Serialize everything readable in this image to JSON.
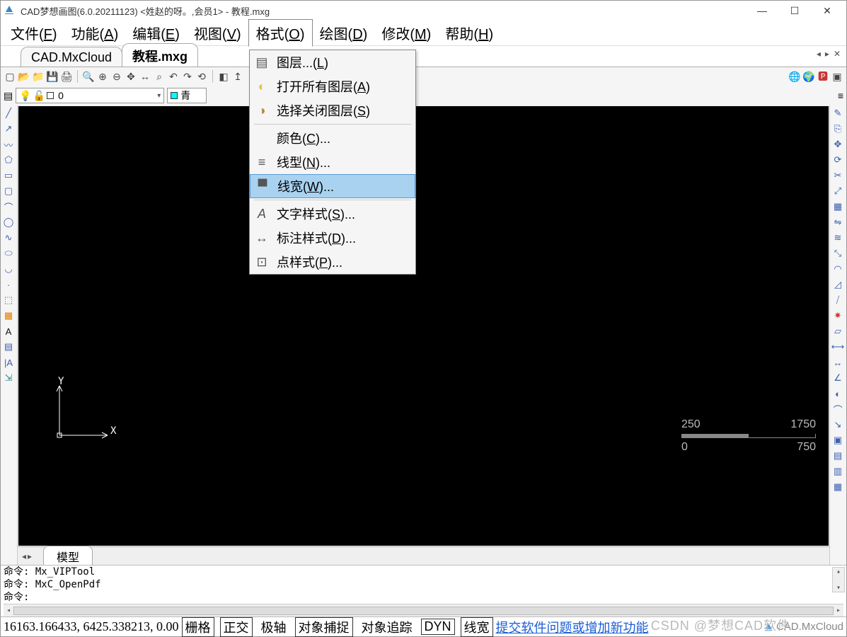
{
  "window": {
    "title": "CAD梦想画图(6.0.20211123) <姓赵的呀。,会员1> - 教程.mxg"
  },
  "menu": {
    "items": [
      {
        "label": "文件(",
        "u": "F",
        "tail": ")"
      },
      {
        "label": "功能(",
        "u": "A",
        "tail": ")"
      },
      {
        "label": "编辑(",
        "u": "E",
        "tail": ")"
      },
      {
        "label": "视图(",
        "u": "V",
        "tail": ")"
      },
      {
        "label": "格式(",
        "u": "O",
        "tail": ")"
      },
      {
        "label": "绘图(",
        "u": "D",
        "tail": ")"
      },
      {
        "label": "修改(",
        "u": "M",
        "tail": ")"
      },
      {
        "label": "帮助(",
        "u": "H",
        "tail": ")"
      }
    ],
    "open_index": 4
  },
  "dropdown": {
    "items": [
      {
        "icon": "layers-icon",
        "t1": "图层...(",
        "u": "L",
        "t2": ")"
      },
      {
        "icon": "bulb-icon",
        "t1": "打开所有图层(",
        "u": "A",
        "t2": ")"
      },
      {
        "icon": "bulb-off-icon",
        "t1": "选择关闭图层(",
        "u": "S",
        "t2": ")"
      },
      {
        "sep": true
      },
      {
        "icon": "",
        "t1": "颜色(",
        "u": "C",
        "t2": ")..."
      },
      {
        "icon": "linetype-icon",
        "t1": "线型(",
        "u": "N",
        "t2": ")..."
      },
      {
        "icon": "lineweight-icon",
        "t1": "线宽(",
        "u": "W",
        "t2": ")...",
        "sel": true
      },
      {
        "sep": true
      },
      {
        "icon": "textstyle-icon",
        "t1": "文字样式(",
        "u": "S",
        "t2": ")..."
      },
      {
        "icon": "dim-icon",
        "t1": "标注样式(",
        "u": "D",
        "t2": ")..."
      },
      {
        "icon": "point-icon",
        "t1": "点样式(",
        "u": "P",
        "t2": ")..."
      }
    ]
  },
  "tabs": {
    "items": [
      {
        "label": "CAD.MxCloud",
        "active": false
      },
      {
        "label": "教程.mxg",
        "active": true
      }
    ]
  },
  "layerbar": {
    "layer_value": "0",
    "color_value": "青"
  },
  "viewtabs": {
    "items": [
      "模型"
    ]
  },
  "cmd": {
    "l1": "命令: Mx_VIPTool",
    "l2": "命令: MxC_OpenPdf",
    "l3": "命令:"
  },
  "status": {
    "coords": "16163.166433,  6425.338213,  0.00",
    "btns": [
      {
        "t": "栅格",
        "box": true
      },
      {
        "t": "正交",
        "box": true,
        "on": true
      },
      {
        "t": "极轴",
        "box": false
      },
      {
        "t": "对象捕捉",
        "box": true
      },
      {
        "t": "对象追踪",
        "box": false
      },
      {
        "t": "DYN",
        "box": true
      },
      {
        "t": "线宽",
        "box": true
      }
    ],
    "link": "提交软件问题或增加新功能",
    "brand": "CAD.MxCloud",
    "watermark": "CSDN @梦想CAD软件"
  },
  "scale": {
    "a": "250",
    "b": "1750",
    "c": "0",
    "d": "750"
  },
  "axis": {
    "y": "Y",
    "x": "X"
  }
}
